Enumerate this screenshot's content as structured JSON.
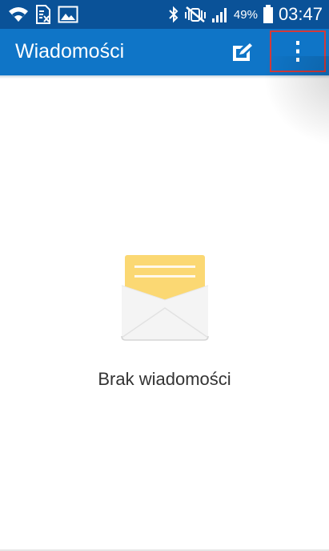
{
  "status_bar": {
    "battery_percent": "49%",
    "time": "03:47",
    "icons": [
      "wifi-icon",
      "no-sim-icon",
      "image-icon",
      "bluetooth-icon",
      "mute-icon",
      "signal-icon",
      "battery-icon"
    ]
  },
  "app_bar": {
    "title": "Wiadomości",
    "compose_icon": "compose-icon",
    "more_icon": "more-vertical-icon"
  },
  "empty_state": {
    "icon": "envelope-icon",
    "message": "Brak wiadomości"
  },
  "colors": {
    "status_bar": "#0a5298",
    "app_bar": "#0f75c7",
    "highlight": "#d33a3a",
    "envelope_letter": "#fbd873",
    "envelope_body": "#f5f5f5"
  }
}
